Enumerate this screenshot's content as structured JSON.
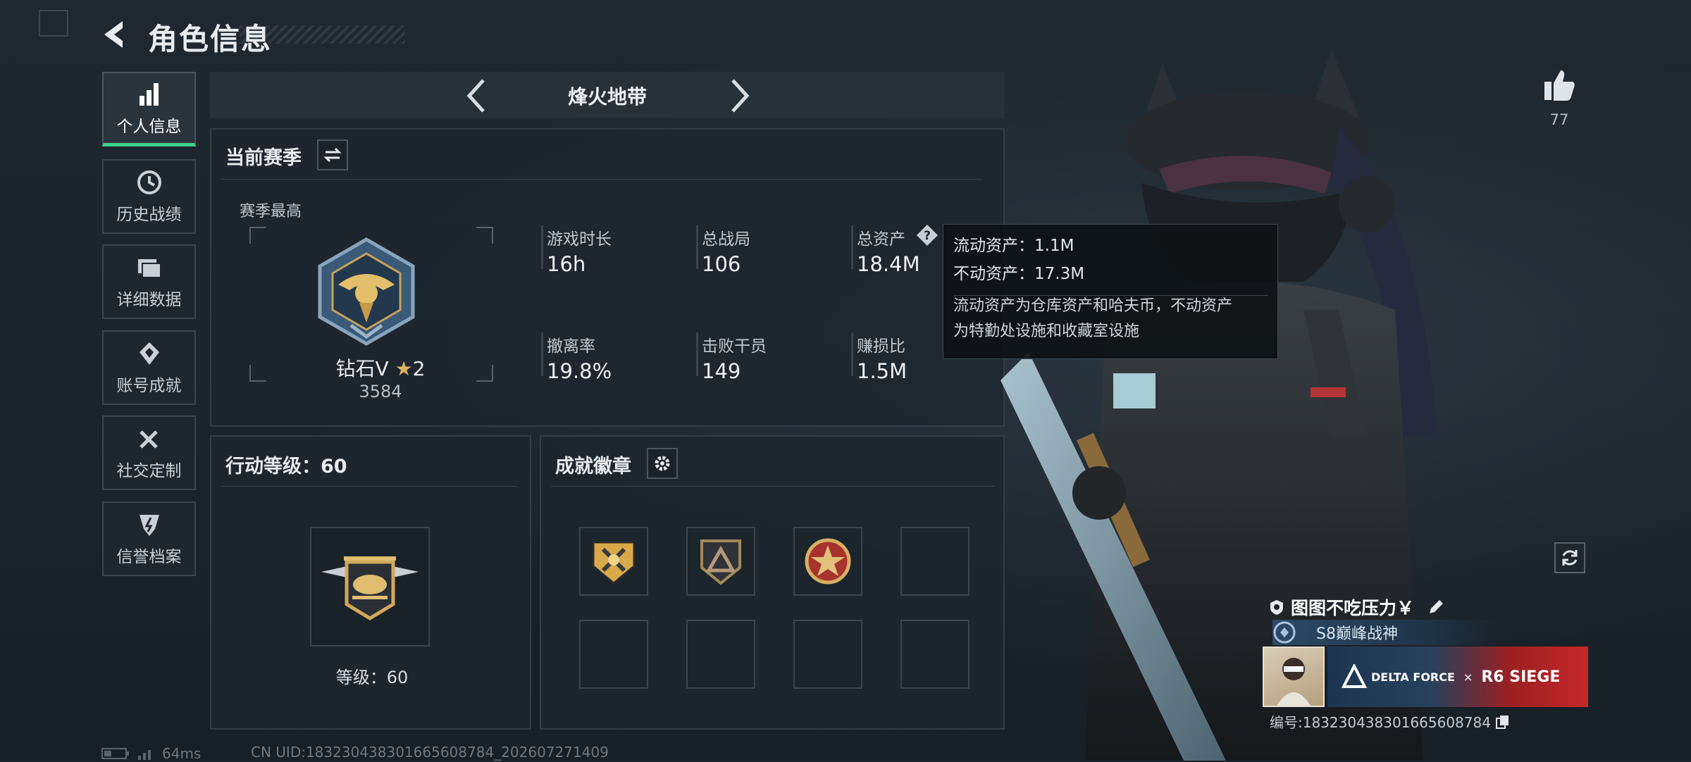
{
  "header": {
    "title": "角色信息"
  },
  "sidebar": {
    "items": [
      {
        "label": "个人信息",
        "icon": "bar-chart-icon",
        "active": true
      },
      {
        "label": "历史战绩",
        "icon": "history-clock-icon",
        "active": false
      },
      {
        "label": "详细数据",
        "icon": "folder-icon",
        "active": false
      },
      {
        "label": "账号成就",
        "icon": "achievement-icon",
        "active": false
      },
      {
        "label": "社交定制",
        "icon": "tools-icon",
        "active": false
      },
      {
        "label": "信誉档案",
        "icon": "shield-badge-icon",
        "active": false
      }
    ]
  },
  "mode": {
    "name": "烽火地带"
  },
  "season": {
    "title": "当前赛季",
    "best_label": "赛季最高",
    "rank_name": "钻石V",
    "rank_stars": "2",
    "rank_score": "3584",
    "stats": [
      {
        "label": "游戏时长",
        "value": "16h"
      },
      {
        "label": "总战局",
        "value": "106"
      },
      {
        "label": "总资产",
        "value": "18.4M"
      },
      {
        "label": "撤离率",
        "value": "19.8%"
      },
      {
        "label": "击败干员",
        "value": "149"
      },
      {
        "label": "赚损比",
        "value": "1.5M"
      }
    ]
  },
  "tooltip": {
    "liquid": "流动资产：1.1M",
    "fixed": "不动资产：17.3M",
    "desc_line1": "流动资产为仓库资产和哈夫币，不动资产",
    "desc_line2": "为特勤处设施和收藏室设施"
  },
  "level": {
    "title": "行动等级：60",
    "caption": "等级：60"
  },
  "badges": {
    "title": "成就徽章",
    "slots": [
      "gold-emblem-icon",
      "triangle-shield-icon",
      "red-star-medal-icon",
      "",
      "",
      "",
      "",
      ""
    ]
  },
  "profile": {
    "likes": "77",
    "player_name": "图图不吃压力￥",
    "title_badge": "S8巅峰战神",
    "banner_text_left": "DELTA FORCE",
    "banner_x": "×",
    "banner_text_right": "R6 SIEGE",
    "player_id": "编号:18323043830166560878​4"
  },
  "footer": {
    "ping": "64ms",
    "uid": "CN UID:18323043830166560878​4_202607271409"
  },
  "colors": {
    "accent": "#3fd08c",
    "panel": "#1e272f",
    "border": "#323d47"
  }
}
